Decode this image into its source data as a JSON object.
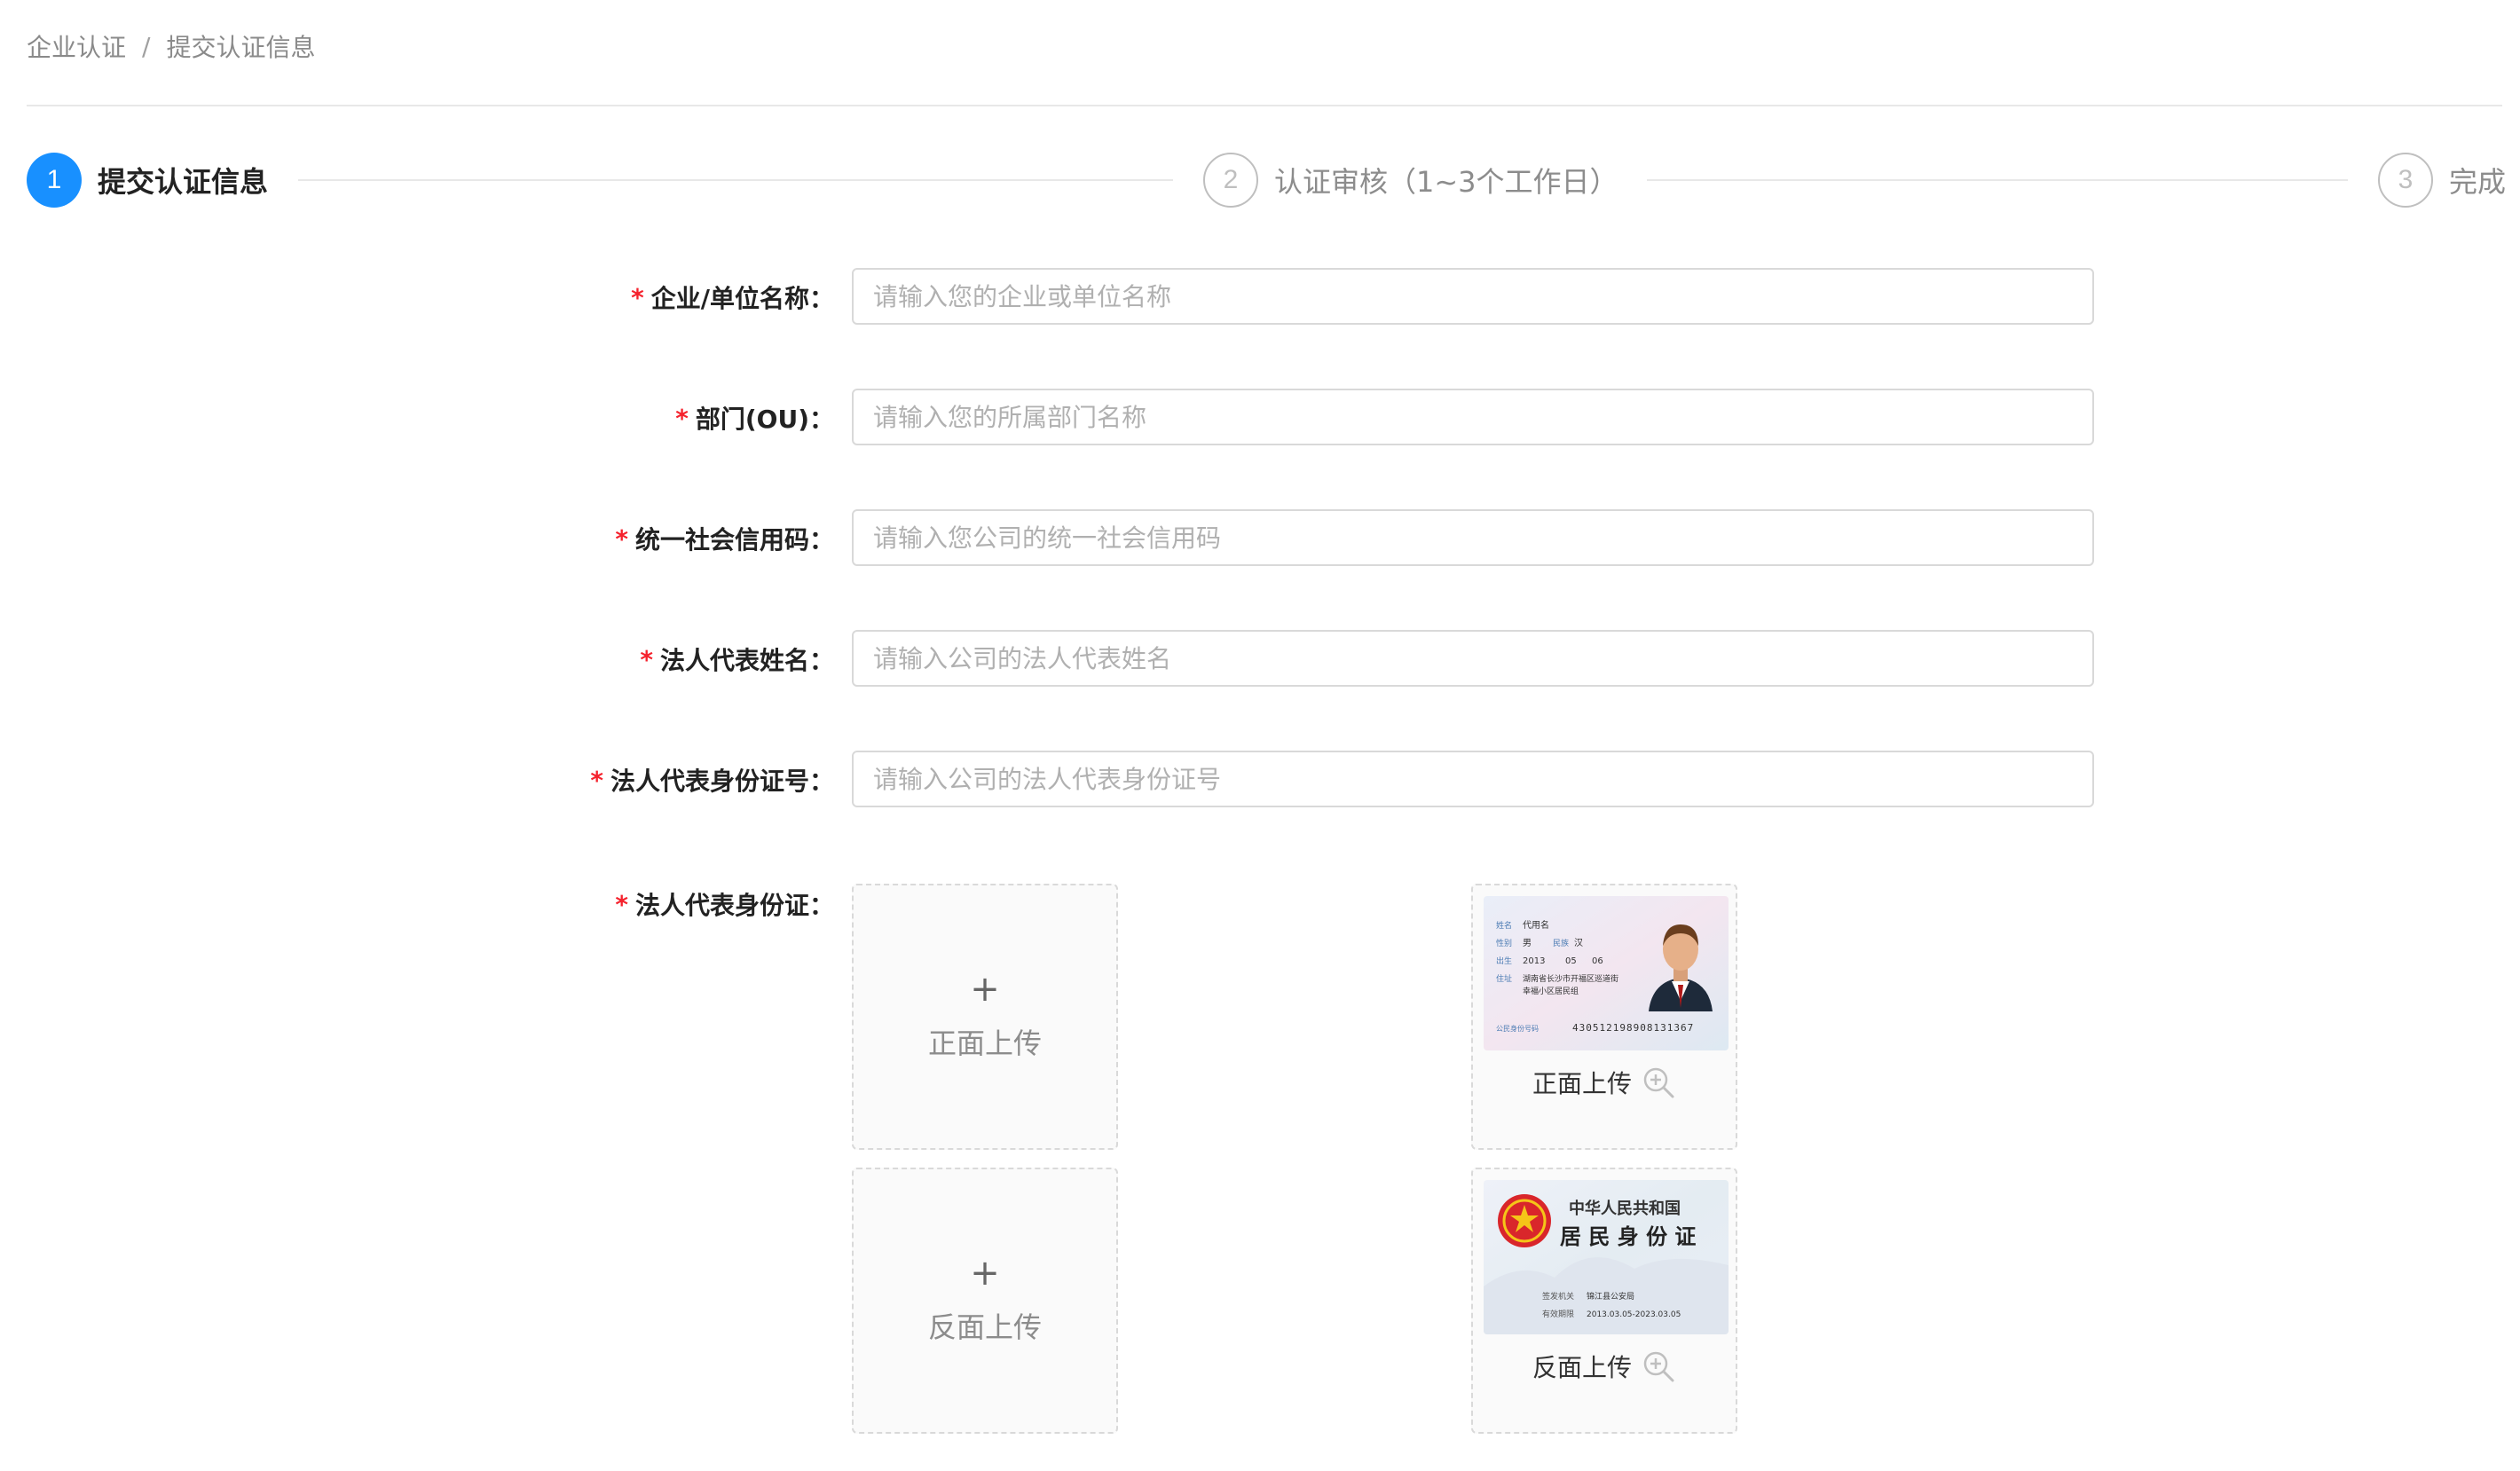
{
  "breadcrumb": {
    "items": [
      "企业认证",
      "提交认证信息"
    ],
    "separator": "/"
  },
  "steps": [
    {
      "number": "1",
      "label": "提交认证信息",
      "status": "active"
    },
    {
      "number": "2",
      "label": "认证审核（1~3个工作日）",
      "status": "wait"
    },
    {
      "number": "3",
      "label": "完成",
      "status": "wait"
    }
  ],
  "form": {
    "required_mark": "*",
    "fields": [
      {
        "label": "企业/单位名称：",
        "placeholder": "请输入您的企业或单位名称",
        "value": ""
      },
      {
        "label": "部门(OU)：",
        "placeholder": "请输入您的所属部门名称",
        "value": ""
      },
      {
        "label": "统一社会信用码：",
        "placeholder": "请输入您公司的统一社会信用码",
        "value": ""
      },
      {
        "label": "法人代表姓名：",
        "placeholder": "请输入公司的法人代表姓名",
        "value": ""
      },
      {
        "label": "法人代表身份证号：",
        "placeholder": "请输入公司的法人代表身份证号",
        "value": ""
      }
    ],
    "id_card": {
      "label": "法人代表身份证：",
      "upload_icon": "+",
      "front_upload_label": "正面上传",
      "back_upload_label": "反面上传",
      "front_sample_caption": "正面上传",
      "back_sample_caption": "反面上传",
      "front_sample": {
        "name": "代用名",
        "gender": "男",
        "ethnicity": "汉",
        "birth_year": "2013",
        "birth_month": "05",
        "birth_day": "06",
        "address_line1": "湖南省长沙市开福区巡道街",
        "address_line2": "幸福小区居民组",
        "id_number": "430512198908131367",
        "field_name": "姓名",
        "field_gender": "性别",
        "field_ethnicity": "民族",
        "field_birth": "出生",
        "field_address": "住址",
        "field_id": "公民身份号码"
      },
      "back_sample": {
        "country": "中华人民共和国",
        "doc_title": "居 民 身 份 证",
        "authority_label": "签发机关",
        "authority": "锦江县公安局",
        "validity_label": "有效期限",
        "validity": "2013.03.05-2023.03.05"
      }
    }
  },
  "colors": {
    "primary": "#1890ff",
    "required": "#f5222d",
    "border": "#d9d9d9"
  },
  "icons": {
    "zoom": "zoom-in-icon",
    "upload": "plus-icon"
  }
}
